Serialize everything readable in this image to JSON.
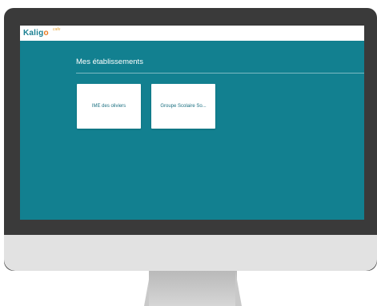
{
  "app": {
    "logo_text_main": "Kalig",
    "logo_text_o": "o",
    "logo_superscript": "cafe"
  },
  "main": {
    "section_title": "Mes établissements",
    "cards": [
      {
        "label": "IME des oliviers"
      },
      {
        "label": "Groupe Scolaire So..."
      }
    ]
  },
  "colors": {
    "screen_bg": "#128090",
    "topbar_bg": "#ffffff",
    "brand_teal": "#1a7f92",
    "brand_orange": "#e87a23"
  }
}
